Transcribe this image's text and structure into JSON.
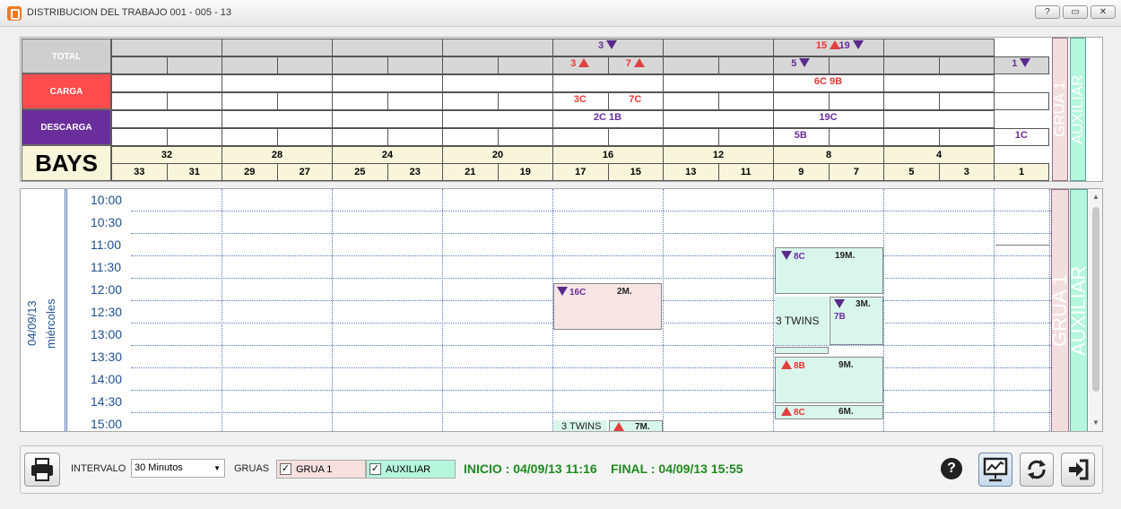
{
  "window": {
    "title": "DISTRIBUCION DEL TRABAJO 001 - 005 - 13",
    "buttons": [
      "?",
      "▭",
      "✕"
    ]
  },
  "summary": {
    "row_labels": {
      "total": "TOTAL",
      "carga": "CARGA",
      "descarga": "DESCARGA",
      "bays": "BAYS"
    },
    "colors": {
      "carga": "#ff4c4c",
      "descarga": "#6a2d9c",
      "total": "#d7d7d7",
      "bays": "#f7f5da"
    },
    "total_top": [
      {
        "col": 4,
        "text": "3",
        "dir": "down",
        "color": "purple"
      },
      {
        "col": 6,
        "text": "15",
        "dir": "up",
        "color": "red"
      },
      {
        "col": 6.5,
        "text": "19",
        "dir": "down",
        "color": "purple"
      }
    ],
    "total_bottom": [
      {
        "col": 8,
        "text": "3",
        "dir": "up",
        "color": "red"
      },
      {
        "col": 9,
        "text": "7",
        "dir": "up",
        "color": "red"
      },
      {
        "col": 12,
        "text": "5",
        "dir": "down",
        "color": "purple"
      },
      {
        "col": 16,
        "text": "1",
        "dir": "down",
        "color": "purple"
      }
    ],
    "carga_top": [
      {
        "col": 6,
        "text": "6C 9B"
      }
    ],
    "carga_bottom": [
      {
        "col": 8,
        "text": "3C"
      },
      {
        "col": 9,
        "text": "7C"
      }
    ],
    "descarga_top": [
      {
        "col": 4,
        "text": "2C 1B"
      },
      {
        "col": 6,
        "text": "19C"
      }
    ],
    "descarga_bottom": [
      {
        "col": 12,
        "text": "5B"
      },
      {
        "col": 16,
        "text": "1C"
      }
    ],
    "bays_even": [
      "32",
      "28",
      "24",
      "20",
      "16",
      "12",
      "8",
      "4"
    ],
    "bays_odd": [
      "33",
      "31",
      "29",
      "27",
      "25",
      "23",
      "21",
      "19",
      "17",
      "15",
      "13",
      "11",
      "9",
      "7",
      "5",
      "3",
      "1"
    ],
    "side_labels": {
      "grua": "GRUA 1",
      "auxiliar": "AUXILIAR"
    }
  },
  "schedule": {
    "date": "04/09/13",
    "weekday": "miércoles",
    "times": [
      "10:00",
      "10:30",
      "11:00",
      "11:30",
      "12:00",
      "12:30",
      "13:00",
      "13:30",
      "14:00",
      "14:30",
      "15:00"
    ],
    "blocks": [
      {
        "name": "block-8c-19m",
        "text_a": "8C",
        "text_b": "19M.",
        "dir": "down",
        "color": "mint"
      },
      {
        "name": "block-16c-2m",
        "text_a": "16C",
        "text_b": "2M.",
        "dir": "down",
        "color": "pink"
      },
      {
        "name": "block-7b-3m",
        "text_a": "7B",
        "text_b": "3M.",
        "dir": "down",
        "color": "mint"
      },
      {
        "name": "block-8b-9m",
        "text_a": "8B",
        "text_b": "9M.",
        "dir": "up",
        "color": "mint"
      },
      {
        "name": "block-8c-6m",
        "text_a": "8C",
        "text_b": "6M.",
        "dir": "up",
        "color": "mint"
      },
      {
        "name": "block-7m",
        "text_a": "",
        "text_b": "7M.",
        "dir": "up",
        "color": "mint"
      }
    ],
    "twins_labels": [
      "3 TWINS",
      "3 TWINS"
    ],
    "side_labels": {
      "grua": "GRUA 1",
      "auxiliar": "AUXILIAR"
    }
  },
  "bottom": {
    "intervalo_label": "INTERVALO",
    "intervalo_value": "30 Minutos",
    "gruas_label": "GRUAS",
    "grua1_label": "GRUA  1",
    "auxiliar_label": "AUXILIAR",
    "inicio": "INICIO : 04/09/13 11:16",
    "final": "FINAL : 04/09/13 15:55"
  }
}
